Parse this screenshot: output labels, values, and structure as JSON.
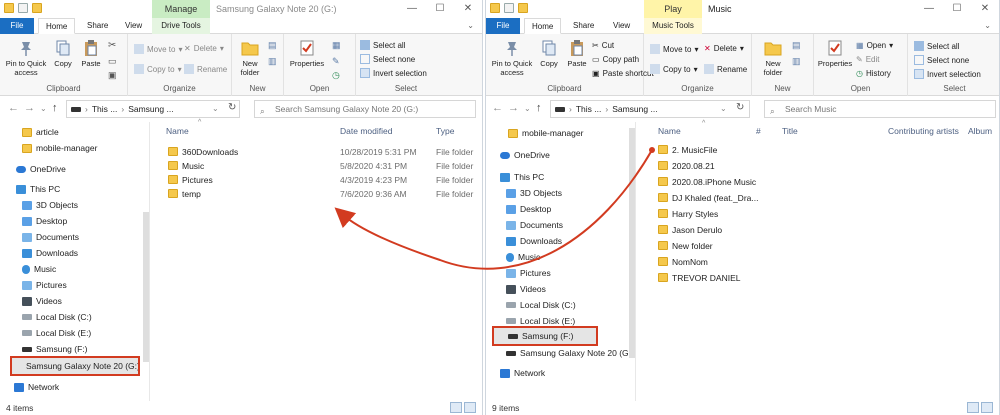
{
  "left": {
    "context_tab": "Manage",
    "title": "Samsung Galaxy Note 20 (G:)",
    "tabs": [
      "File",
      "Home",
      "Share",
      "View",
      "Drive Tools"
    ],
    "ribbon": {
      "pin": "Pin to Quick access",
      "copy": "Copy",
      "paste": "Paste",
      "clipboard": "Clipboard",
      "move_to": "Move to",
      "copy_to": "Copy to",
      "delete": "Delete",
      "rename": "Rename",
      "organize": "Organize",
      "new_folder": "New folder",
      "new": "New",
      "properties": "Properties",
      "open": "Open",
      "select_all": "Select all",
      "select_none": "Select none",
      "invert": "Invert selection",
      "select": "Select"
    },
    "address": {
      "crumb1": "This ...",
      "crumb2": "Samsung ...",
      "search_placeholder": "Search Samsung Galaxy Note 20 (G:)"
    },
    "nav": [
      "article",
      "mobile-manager",
      "OneDrive",
      "This PC",
      "3D Objects",
      "Desktop",
      "Documents",
      "Downloads",
      "Music",
      "Pictures",
      "Videos",
      "Local Disk (C:)",
      "Local Disk (E:)",
      "Samsung (F:)",
      "Samsung Galaxy Note 20 (G:)",
      "Network"
    ],
    "columns": [
      "Name",
      "Date modified",
      "Type"
    ],
    "files": [
      {
        "name": "360Downloads",
        "date": "10/28/2019 5:31 PM",
        "type": "File folder"
      },
      {
        "name": "Music",
        "date": "5/8/2020 4:31 PM",
        "type": "File folder"
      },
      {
        "name": "Pictures",
        "date": "4/3/2019 4:23 PM",
        "type": "File folder"
      },
      {
        "name": "temp",
        "date": "7/6/2020 9:36 AM",
        "type": "File folder"
      }
    ],
    "status": "4 items"
  },
  "right": {
    "context_tab": "Play",
    "title": "Music",
    "tabs": [
      "File",
      "Home",
      "Share",
      "View",
      "Music Tools"
    ],
    "ribbon": {
      "pin": "Pin to Quick access",
      "copy": "Copy",
      "paste": "Paste",
      "cut": "Cut",
      "copy_path": "Copy path",
      "paste_shortcut": "Paste shortcut",
      "clipboard": "Clipboard",
      "move_to": "Move to",
      "copy_to": "Copy to",
      "delete": "Delete",
      "rename": "Rename",
      "organize": "Organize",
      "new_folder": "New folder",
      "new": "New",
      "properties": "Properties",
      "open_btn": "Open",
      "edit": "Edit",
      "history": "History",
      "open": "Open",
      "select_all": "Select all",
      "select_none": "Select none",
      "invert": "Invert selection",
      "select": "Select"
    },
    "address": {
      "crumb1": "This ...",
      "crumb2": "Samsung ...",
      "search_placeholder": "Search Music"
    },
    "nav": [
      "mobile-manager",
      "OneDrive",
      "This PC",
      "3D Objects",
      "Desktop",
      "Documents",
      "Downloads",
      "Music",
      "Pictures",
      "Videos",
      "Local Disk (C:)",
      "Local Disk (E:)",
      "Samsung (F:)",
      "Samsung Galaxy Note 20 (G:)",
      "Network"
    ],
    "columns": [
      "Name",
      "#",
      "Title",
      "Contributing artists",
      "Album"
    ],
    "files": [
      "2. MusicFile",
      "2020.08.21",
      "2020.08.iPhone Music",
      "DJ Khaled (feat._Dra...",
      "Harry Styles",
      "Jason Derulo",
      "New folder",
      "NomNom",
      "TREVOR DANIEL"
    ],
    "status": "9 items"
  },
  "colors": {
    "highlight": "#d23b20",
    "accent": "#1b6ec2"
  }
}
